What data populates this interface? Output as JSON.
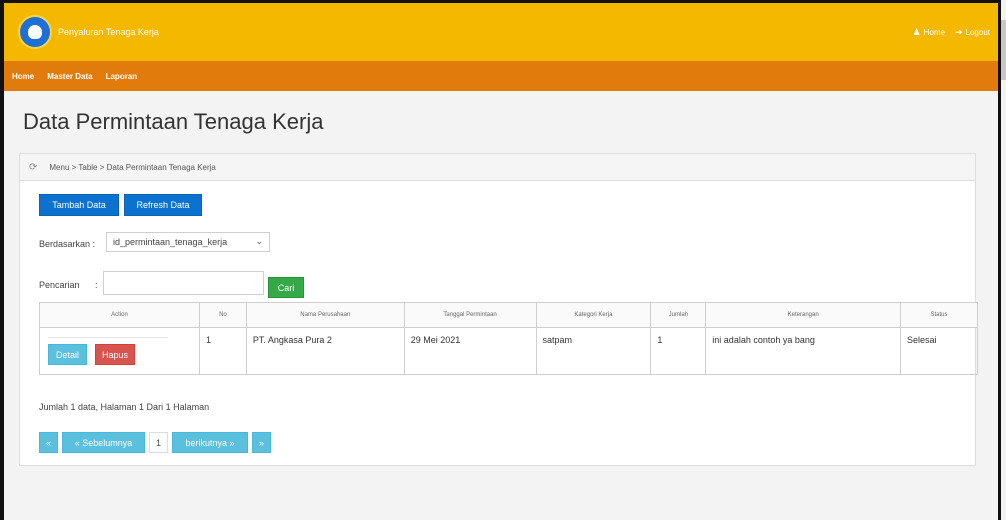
{
  "header": {
    "app_title": "Penyaluran Tenaga Kerja",
    "home_label": "Home",
    "logout_label": "Logout"
  },
  "nav": {
    "items": [
      {
        "label": "Home"
      },
      {
        "label": "Master Data"
      },
      {
        "label": "Laporan"
      }
    ]
  },
  "page": {
    "title": "Data Permintaan Tenaga Kerja",
    "breadcrumb": "Menu > Table > Data Permintaan Tenaga Kerja"
  },
  "toolbar": {
    "tambah_label": "Tambah Data",
    "refresh_label": "Refresh Data"
  },
  "filter": {
    "berdasarkan_label": "Berdasarkan :",
    "selected_option": "id_permintaan_tenaga_kerja",
    "pencarian_label": "Pencarian",
    "colon": ":",
    "search_value": "",
    "cari_label": "Cari"
  },
  "table": {
    "columns": [
      "Action",
      "No",
      "Nama Perusahaan",
      "Tanggal Permintaan",
      "Kategori Kerja",
      "Jumlah",
      "Keterangan",
      "Status"
    ],
    "rows": [
      {
        "detail_label": "Detail",
        "hapus_label": "Hapus",
        "no": "1",
        "nama_perusahaan": "PT. Angkasa Pura 2",
        "tanggal": "29 Mei 2021",
        "kategori": "satpam",
        "jumlah": "1",
        "keterangan": "ini adalah contoh ya bang",
        "status": "Selesai"
      }
    ]
  },
  "summary": "Jumlah 1 data, Halaman 1 Dari 1 Halaman",
  "pager": {
    "first": "«",
    "prev": "« Sebelumnya",
    "page": "1",
    "next": "berikutnya »",
    "last": "»"
  },
  "colors": {
    "topbar": "#f4b800",
    "navbar": "#e07b0c",
    "primary": "#0b73cf",
    "success": "#35a847",
    "info": "#5bc0de",
    "danger": "#d9534f"
  },
  "icons": [
    "user-logo-icon",
    "user-icon",
    "logout-arrow-icon",
    "refresh-icon",
    "chevron-down-icon"
  ]
}
